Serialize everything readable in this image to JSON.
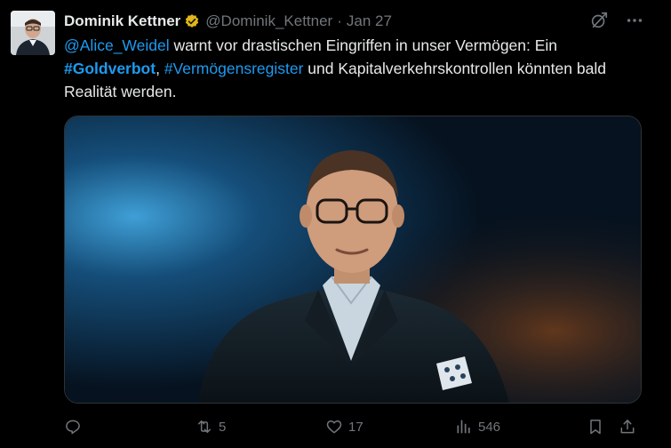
{
  "tweet": {
    "author": {
      "display_name": "Dominik Kettner",
      "handle": "@Dominik_Kettner",
      "verified_icon": "verified-badge-icon",
      "avatar_icon": "avatar"
    },
    "separator": "·",
    "date": "Jan 27",
    "text": {
      "mention": "@Alice_Weidel",
      "part1": " warnt vor drastischen Eingriffen in unser Vermögen: Ein ",
      "hashtag1": "#Goldverbot",
      "comma": ", ",
      "hashtag2": "#Vermögensregister",
      "part2": " und Kapitalverkehrskontrollen könnten bald Realität werden."
    },
    "media": {
      "type": "video",
      "description_icon": "video-thumbnail"
    },
    "actions": {
      "reply": {
        "icon": "reply-icon",
        "count": ""
      },
      "retweet": {
        "icon": "retweet-icon",
        "count": "5"
      },
      "like": {
        "icon": "heart-icon",
        "count": "17"
      },
      "views": {
        "icon": "views-icon",
        "count": "546"
      },
      "bookmark": {
        "icon": "bookmark-icon"
      },
      "share": {
        "icon": "share-icon"
      }
    },
    "top_icons": [
      "grok-icon",
      "more-icon"
    ]
  },
  "colors": {
    "background": "#000000",
    "text": "#e7e9ea",
    "secondary": "#71767b",
    "link": "#1d9bf0",
    "verified": "#e2b719"
  }
}
